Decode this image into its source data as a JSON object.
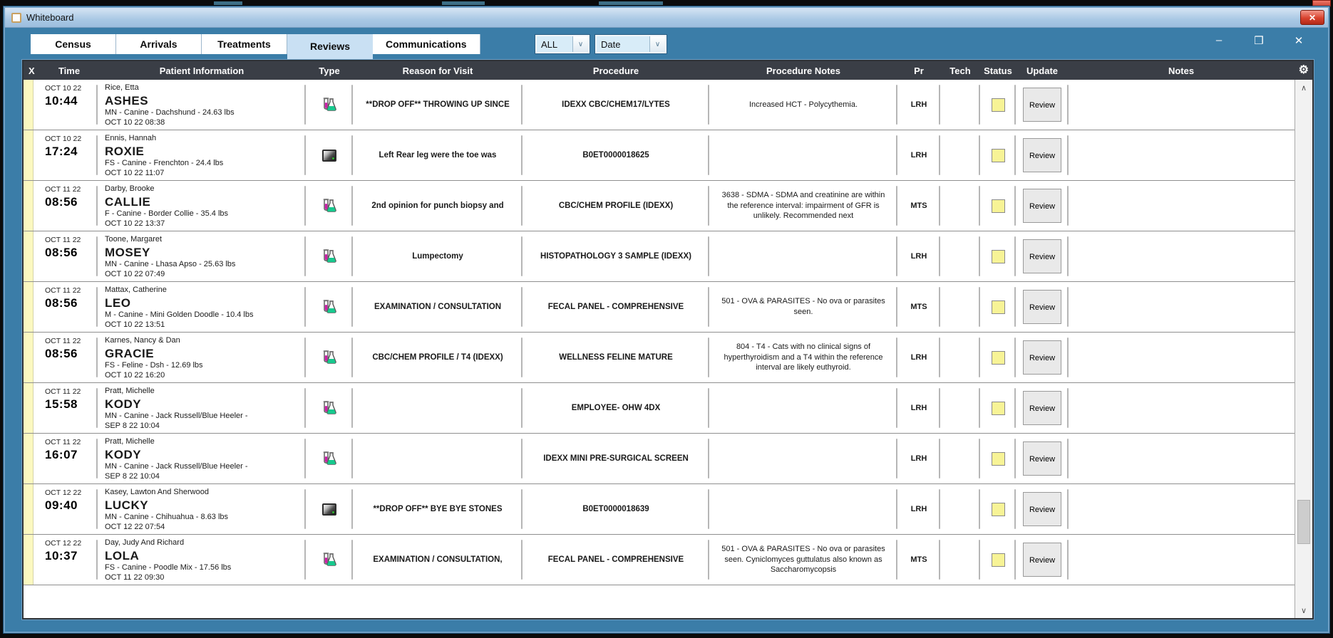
{
  "window": {
    "title": "Whiteboard",
    "close_glyph": "✕"
  },
  "toolbar": {
    "tabs": [
      {
        "label": "Census",
        "active": false
      },
      {
        "label": "Arrivals",
        "active": false
      },
      {
        "label": "Treatments",
        "active": false
      },
      {
        "label": "Reviews",
        "active": true
      },
      {
        "label": "Communications",
        "active": false
      }
    ],
    "filters": [
      {
        "value": "ALL"
      },
      {
        "value": "Date"
      }
    ],
    "window_controls": {
      "minimize": "–",
      "maximize": "❒",
      "close": "✕"
    }
  },
  "icons": {
    "gear": "⚙",
    "combo_arrow": "∨",
    "scroll_up": "∧",
    "scroll_down": "∨"
  },
  "colors": {
    "window_teal": "#3b7da8",
    "header_dark": "#3a3e46",
    "tab_active": "#c9e0f3",
    "status_yellow": "#f7f396",
    "row_strip_yellow": "#fbf8c0",
    "close_red": "#d8422e"
  },
  "table": {
    "columns": [
      "X",
      "Time",
      "Patient Information",
      "Type",
      "Reason for Visit",
      "Procedure",
      "Procedure Notes",
      "Pr",
      "Tech",
      "Status",
      "Update",
      "Notes"
    ],
    "rows": [
      {
        "date": "OCT 10 22",
        "time": "10:44",
        "owner": "Rice, Etta",
        "pet": "ASHES",
        "details": "MN - Canine - Dachshund - 24.63 lbs",
        "checkin": "OCT 10 22  08:38",
        "type": "lab",
        "reason": "**DROP OFF** THROWING UP SINCE",
        "procedure": "IDEXX  CBC/CHEM17/LYTES",
        "procedure_notes": "Increased HCT - Polycythemia.",
        "pr": "LRH",
        "tech": "",
        "status": "yellow",
        "update_label": "Review",
        "notes": ""
      },
      {
        "date": "OCT 10 22",
        "time": "17:24",
        "owner": "Ennis, Hannah",
        "pet": "ROXIE",
        "details": "FS - Canine - Frenchton - 24.4 lbs",
        "checkin": "OCT 10 22  11:07",
        "type": "xray",
        "reason": "Left  Rear leg were the toe was",
        "procedure": "B0ET0000018625",
        "procedure_notes": "",
        "pr": "LRH",
        "tech": "",
        "status": "yellow",
        "update_label": "Review",
        "notes": ""
      },
      {
        "date": "OCT 11 22",
        "time": "08:56",
        "owner": "Darby, Brooke",
        "pet": "CALLIE",
        "details": "F - Canine - Border Collie - 35.4 lbs",
        "checkin": "OCT 10 22  13:37",
        "type": "lab",
        "reason": "2nd opinion for punch biopsy and",
        "procedure": "CBC/CHEM PROFILE  (IDEXX)",
        "procedure_notes": "3638 - SDMA - SDMA and creatinine are within the reference interval: impairment of GFR is unlikely. Recommended next",
        "pr": "MTS",
        "tech": "",
        "status": "yellow",
        "update_label": "Review",
        "notes": ""
      },
      {
        "date": "OCT 11 22",
        "time": "08:56",
        "owner": "Toone, Margaret",
        "pet": "MOSEY",
        "details": "MN - Canine - Lhasa Apso - 25.63 lbs",
        "checkin": "OCT 10 22  07:49",
        "type": "lab",
        "reason": "Lumpectomy",
        "procedure": "HISTOPATHOLOGY 3 SAMPLE (IDEXX)",
        "procedure_notes": "",
        "pr": "LRH",
        "tech": "",
        "status": "yellow",
        "update_label": "Review",
        "notes": ""
      },
      {
        "date": "OCT 11 22",
        "time": "08:56",
        "owner": "Mattax, Catherine",
        "pet": "LEO",
        "details": "M - Canine - Mini Golden Doodle - 10.4 lbs",
        "checkin": "OCT 10 22  13:51",
        "type": "lab",
        "reason": "EXAMINATION / CONSULTATION",
        "procedure": "FECAL   PANEL - COMPREHENSIVE",
        "procedure_notes": "501 - OVA & PARASITES - No ova or parasites seen.",
        "pr": "MTS",
        "tech": "",
        "status": "yellow",
        "update_label": "Review",
        "notes": ""
      },
      {
        "date": "OCT 11 22",
        "time": "08:56",
        "owner": "Karnes, Nancy & Dan",
        "pet": "GRACIE",
        "details": "FS - Feline - Dsh - 12.69 lbs",
        "checkin": "OCT 10 22  16:20",
        "type": "lab",
        "reason": "CBC/CHEM PROFILE / T4 (IDEXX)",
        "procedure": "WELLNESS FELINE MATURE",
        "procedure_notes": "804 - T4 - Cats with no clinical signs of hyperthyroidism and a T4 within the reference interval are likely euthyroid.",
        "pr": "LRH",
        "tech": "",
        "status": "yellow",
        "update_label": "Review",
        "notes": ""
      },
      {
        "date": "OCT 11 22",
        "time": "15:58",
        "owner": "Pratt, Michelle",
        "pet": "KODY",
        "details": "MN - Canine - Jack Russell/Blue Heeler -",
        "checkin": "SEP 8 22  10:04",
        "type": "lab",
        "reason": "",
        "procedure": "EMPLOYEE- OHW 4DX",
        "procedure_notes": "",
        "pr": "LRH",
        "tech": "",
        "status": "yellow",
        "update_label": "Review",
        "notes": ""
      },
      {
        "date": "OCT 11 22",
        "time": "16:07",
        "owner": "Pratt, Michelle",
        "pet": "KODY",
        "details": "MN - Canine - Jack Russell/Blue Heeler -",
        "checkin": "SEP 8 22  10:04",
        "type": "lab",
        "reason": "",
        "procedure": "IDEXX  MINI PRE-SURGICAL SCREEN",
        "procedure_notes": "",
        "pr": "LRH",
        "tech": "",
        "status": "yellow",
        "update_label": "Review",
        "notes": ""
      },
      {
        "date": "OCT 12 22",
        "time": "09:40",
        "owner": "Kasey, Lawton And Sherwood",
        "pet": "LUCKY",
        "details": "MN - Canine - Chihuahua - 8.63 lbs",
        "checkin": "OCT 12 22  07:54",
        "type": "xray",
        "reason": "**DROP OFF** BYE BYE STONES",
        "procedure": "B0ET0000018639",
        "procedure_notes": "",
        "pr": "LRH",
        "tech": "",
        "status": "yellow",
        "update_label": "Review",
        "notes": ""
      },
      {
        "date": "OCT 12 22",
        "time": "10:37",
        "owner": "Day, Judy And Richard",
        "pet": "LOLA",
        "details": "FS - Canine - Poodle  Mix - 17.56 lbs",
        "checkin": "OCT 11 22  09:30",
        "type": "lab",
        "reason": "EXAMINATION / CONSULTATION,",
        "procedure": "FECAL   PANEL - COMPREHENSIVE",
        "procedure_notes": "501 - OVA & PARASITES - No ova or parasites seen. Cyniclomyces guttulatus also known as Saccharomycopsis",
        "pr": "MTS",
        "tech": "",
        "status": "yellow",
        "update_label": "Review",
        "notes": ""
      }
    ]
  }
}
